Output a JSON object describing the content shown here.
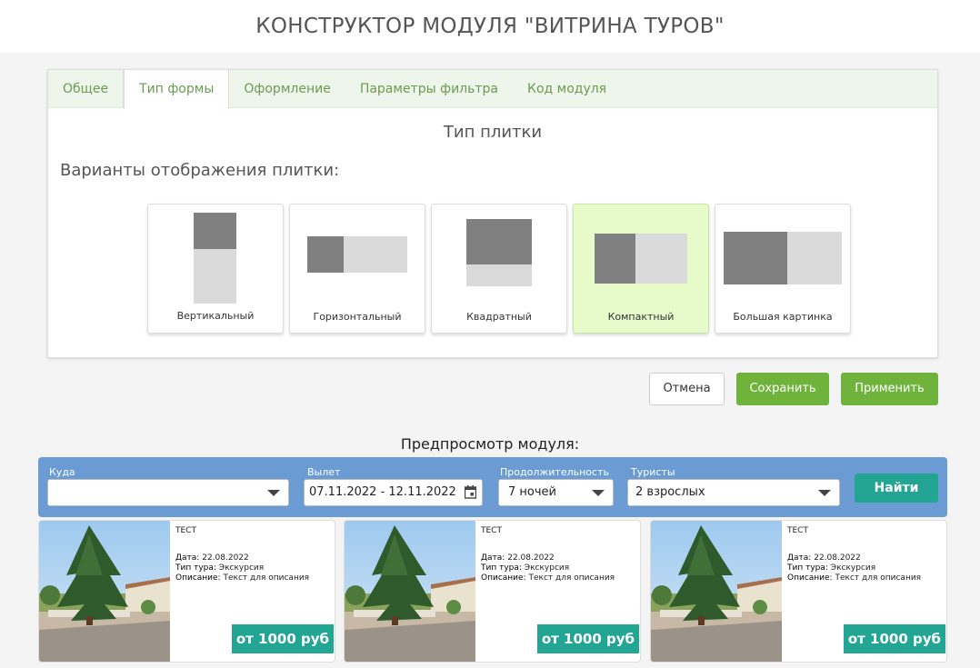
{
  "header": {
    "title": "КОНСТРУКТОР МОДУЛЯ \"ВИТРИНА ТУРОВ\""
  },
  "tabs": [
    {
      "label": "Общее"
    },
    {
      "label": "Тип формы"
    },
    {
      "label": "Оформление"
    },
    {
      "label": "Параметры фильтра"
    },
    {
      "label": "Код модуля"
    }
  ],
  "active_tab": "Тип формы",
  "section": {
    "title": "Тип плитки",
    "variants_label": "Варианты отображения плитки:"
  },
  "tiles": [
    {
      "label": "Вертикальный"
    },
    {
      "label": "Горизонтальный"
    },
    {
      "label": "Квадратный"
    },
    {
      "label": "Компактный"
    },
    {
      "label": "Большая картинка"
    }
  ],
  "selected_tile": "Компактный",
  "actions": {
    "cancel": "Отмена",
    "save": "Сохранить",
    "apply": "Применить"
  },
  "preview": {
    "title": "Предпросмотр модуля:",
    "search": {
      "where_label": "Куда",
      "where_value": "",
      "departure_label": "Вылет",
      "departure_value": "07.11.2022 - 12.11.2022",
      "duration_label": "Продолжительность",
      "duration_value": "7 ночей",
      "tourists_label": "Туристы",
      "tourists_value": "2 взрослых",
      "find_button": "Найти"
    },
    "cards": [
      {
        "title": "ТЕСТ",
        "date_label": "Дата:",
        "date": "22.08.2022",
        "type_label": "Тип тура:",
        "type": "Экскурсия",
        "desc_label": "Описание:",
        "desc": "Текст для описания",
        "price": "от 1000 руб"
      },
      {
        "title": "ТЕСТ",
        "date_label": "Дата:",
        "date": "22.08.2022",
        "type_label": "Тип тура:",
        "type": "Экскурсия",
        "desc_label": "Описание:",
        "desc": "Текст для описания",
        "price": "от 1000 руб"
      },
      {
        "title": "ТЕСТ",
        "date_label": "Дата:",
        "date": "22.08.2022",
        "type_label": "Тип тура:",
        "type": "Экскурсия",
        "desc_label": "Описание:",
        "desc": "Текст для описания",
        "price": "от 1000 руб"
      }
    ]
  },
  "colors": {
    "accent_green": "#6fb33d",
    "tab_text": "#6b9a52",
    "selected_tile_bg": "#e6fbc9",
    "search_bar": "#6a9bd3",
    "teal": "#22a593"
  }
}
